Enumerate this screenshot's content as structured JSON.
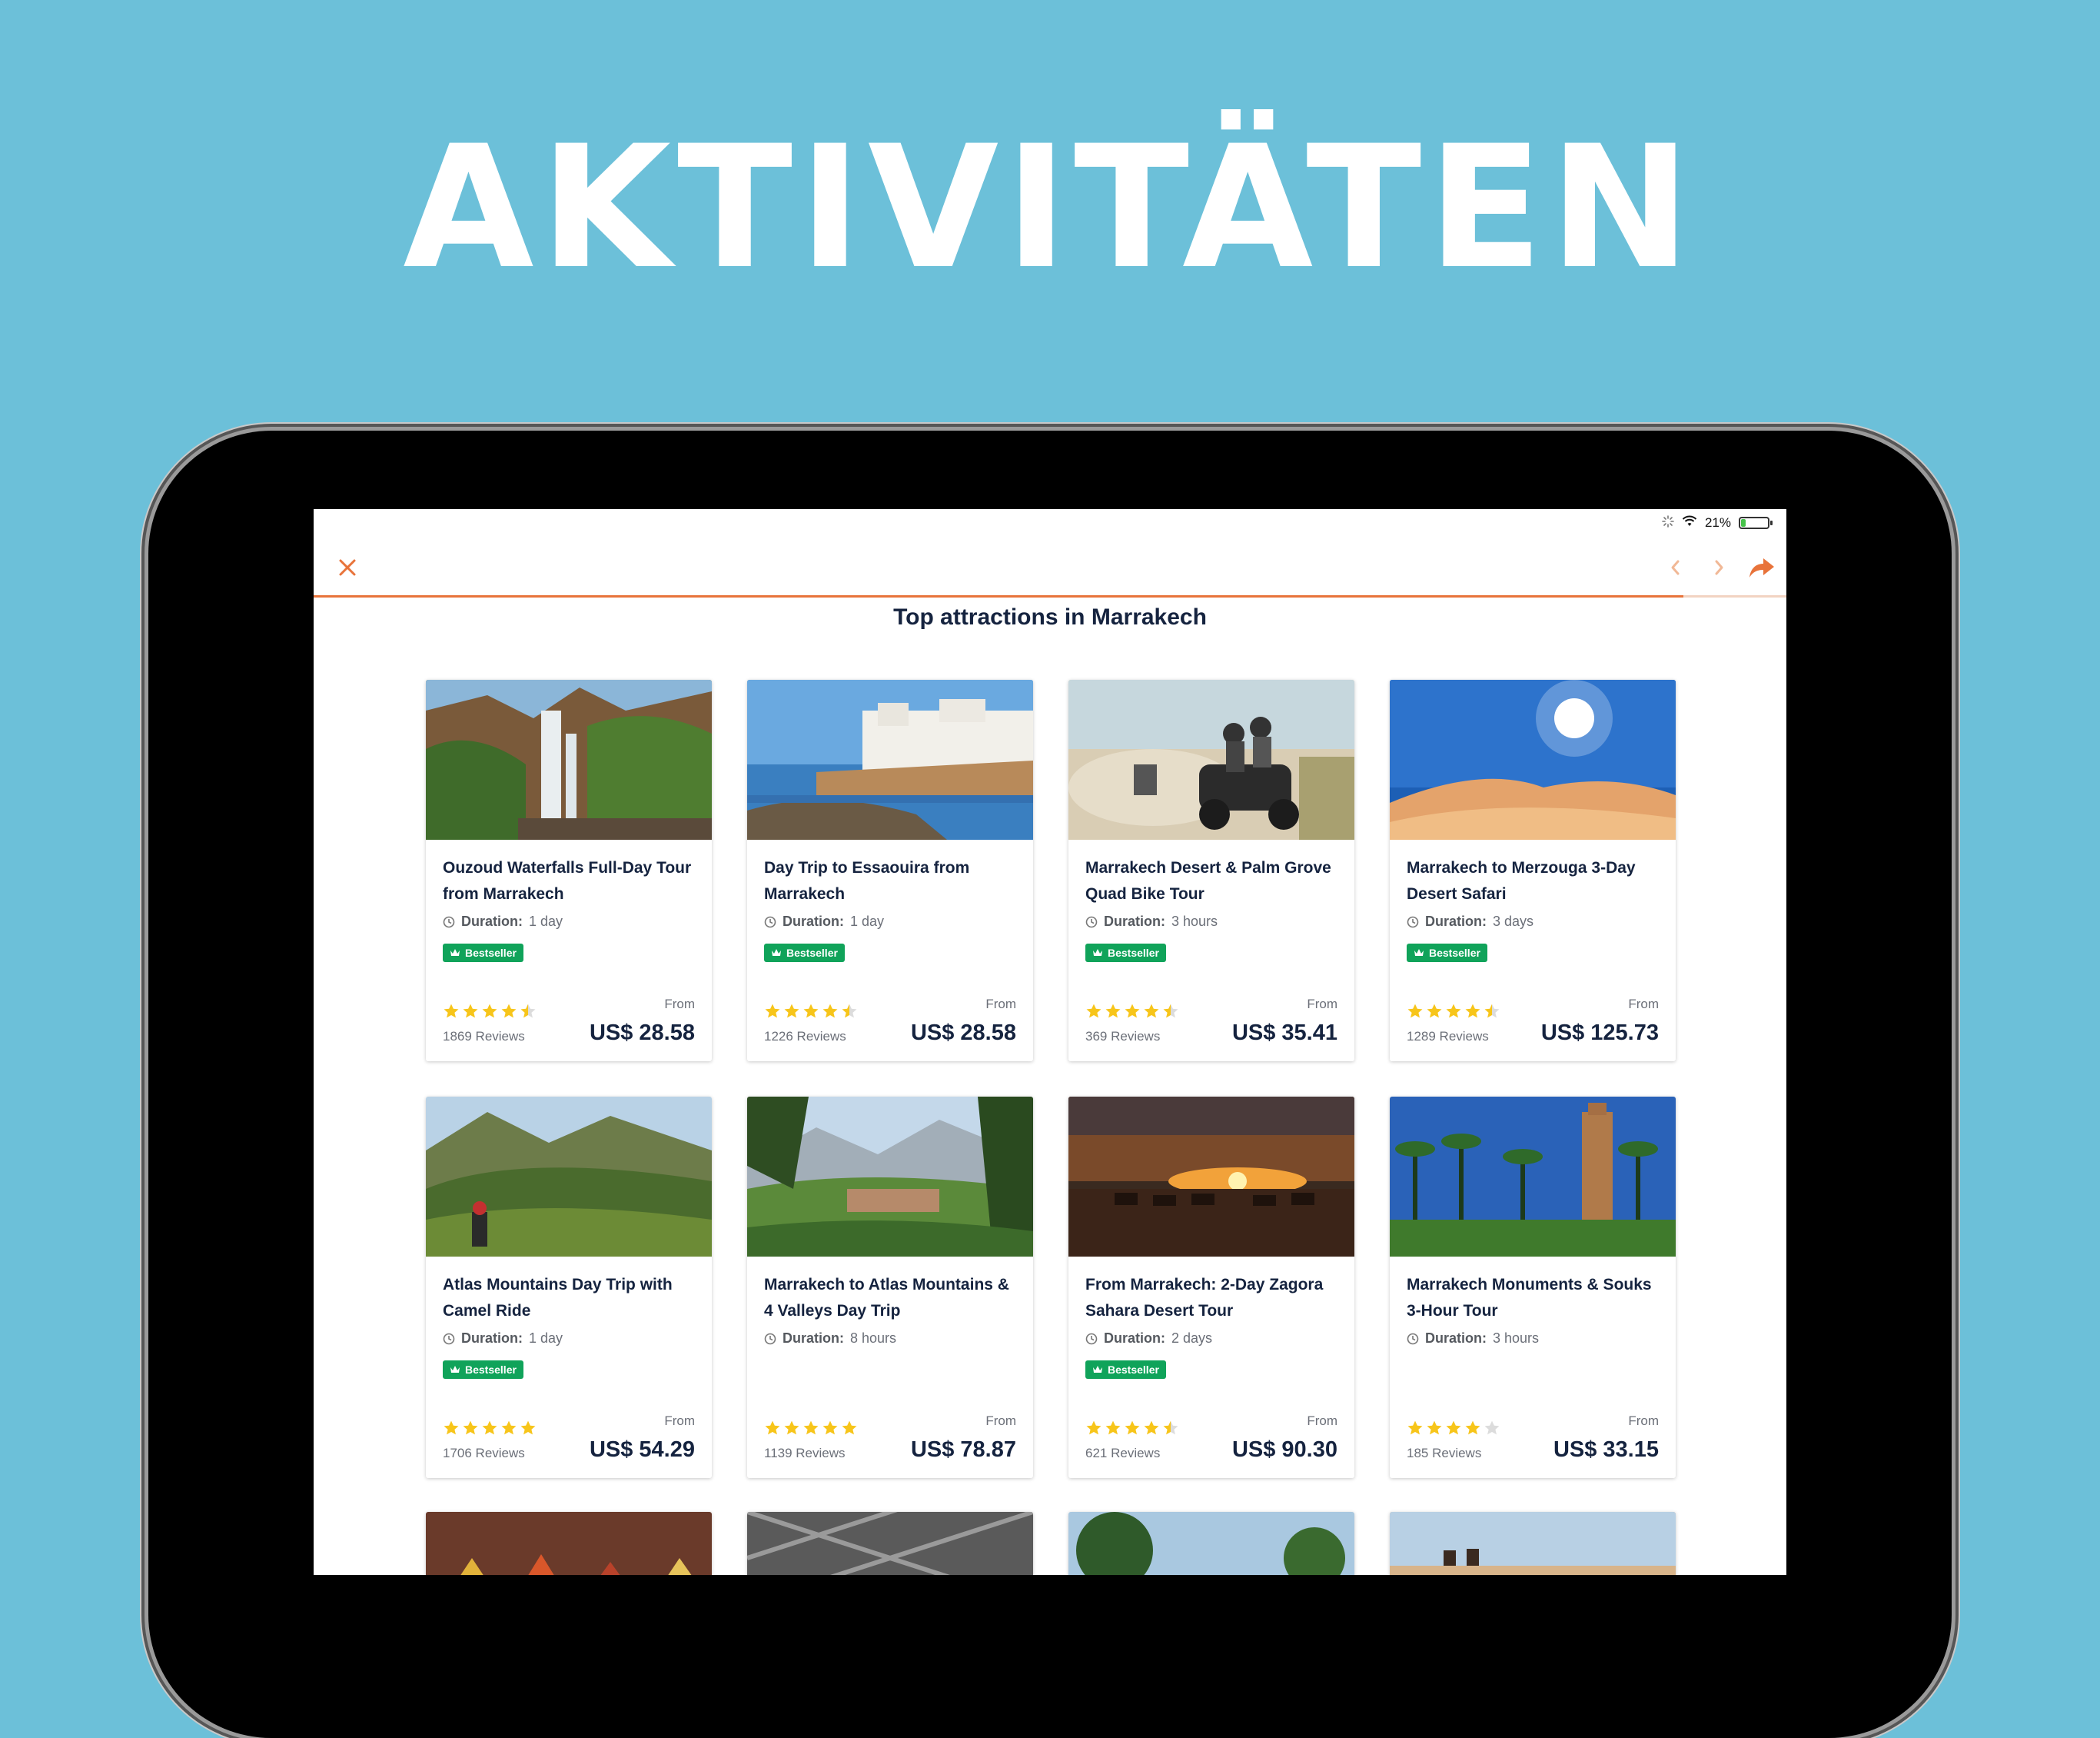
{
  "headline": "AKTIVITÄTEN",
  "status": {
    "battery": "21%",
    "battery_level": 0.21
  },
  "page": {
    "title": "Top attractions in Marrakech",
    "load_progress": 0.93
  },
  "labels": {
    "bestseller": "Bestseller",
    "from": "From",
    "duration": "Duration:"
  },
  "colors": {
    "accent": "#e8733a",
    "badge": "#10a35a",
    "star": "#f7c51a",
    "background": "#6cc0d9"
  },
  "cards": [
    {
      "title": "Ouzoud Waterfalls Full-Day Tour from Marrakech",
      "duration": "1 day",
      "bestseller": true,
      "rating": 4.5,
      "reviews": "1869 Reviews",
      "price": "US$ 28.58",
      "image": "waterfall"
    },
    {
      "title": "Day Trip to Essaouira from Marrakech",
      "duration": "1 day",
      "bestseller": true,
      "rating": 4.5,
      "reviews": "1226 Reviews",
      "price": "US$ 28.58",
      "image": "coast"
    },
    {
      "title": "Marrakech Desert & Palm Grove Quad Bike Tour",
      "duration": "3 hours",
      "bestseller": true,
      "rating": 4.5,
      "reviews": "369 Reviews",
      "price": "US$ 35.41",
      "image": "quad"
    },
    {
      "title": "Marrakech to Merzouga 3-Day Desert Safari",
      "duration": "3 days",
      "bestseller": true,
      "rating": 4.5,
      "reviews": "1289 Reviews",
      "price": "US$ 125.73",
      "image": "dunes"
    },
    {
      "title": "Atlas Mountains Day Trip with Camel Ride",
      "duration": "1 day",
      "bestseller": true,
      "rating": 5,
      "reviews": "1706 Reviews",
      "price": "US$ 54.29",
      "image": "mountain"
    },
    {
      "title": "Marrakech to Atlas Mountains & 4 Valleys Day Trip",
      "duration": "8 hours",
      "bestseller": false,
      "rating": 5,
      "reviews": "1139 Reviews",
      "price": "US$ 78.87",
      "image": "valley"
    },
    {
      "title": "From Marrakech: 2-Day Zagora Sahara Desert Tour",
      "duration": "2 days",
      "bestseller": true,
      "rating": 4.5,
      "reviews": "621 Reviews",
      "price": "US$ 90.30",
      "image": "sunset"
    },
    {
      "title": "Marrakech Monuments & Souks 3-Hour Tour",
      "duration": "3 hours",
      "bestseller": false,
      "rating": 4,
      "reviews": "185 Reviews",
      "price": "US$ 33.15",
      "image": "minaret"
    }
  ],
  "partial_cards": [
    {
      "image": "spices"
    },
    {
      "image": "lattice"
    },
    {
      "image": "garden"
    },
    {
      "image": "camels"
    }
  ]
}
